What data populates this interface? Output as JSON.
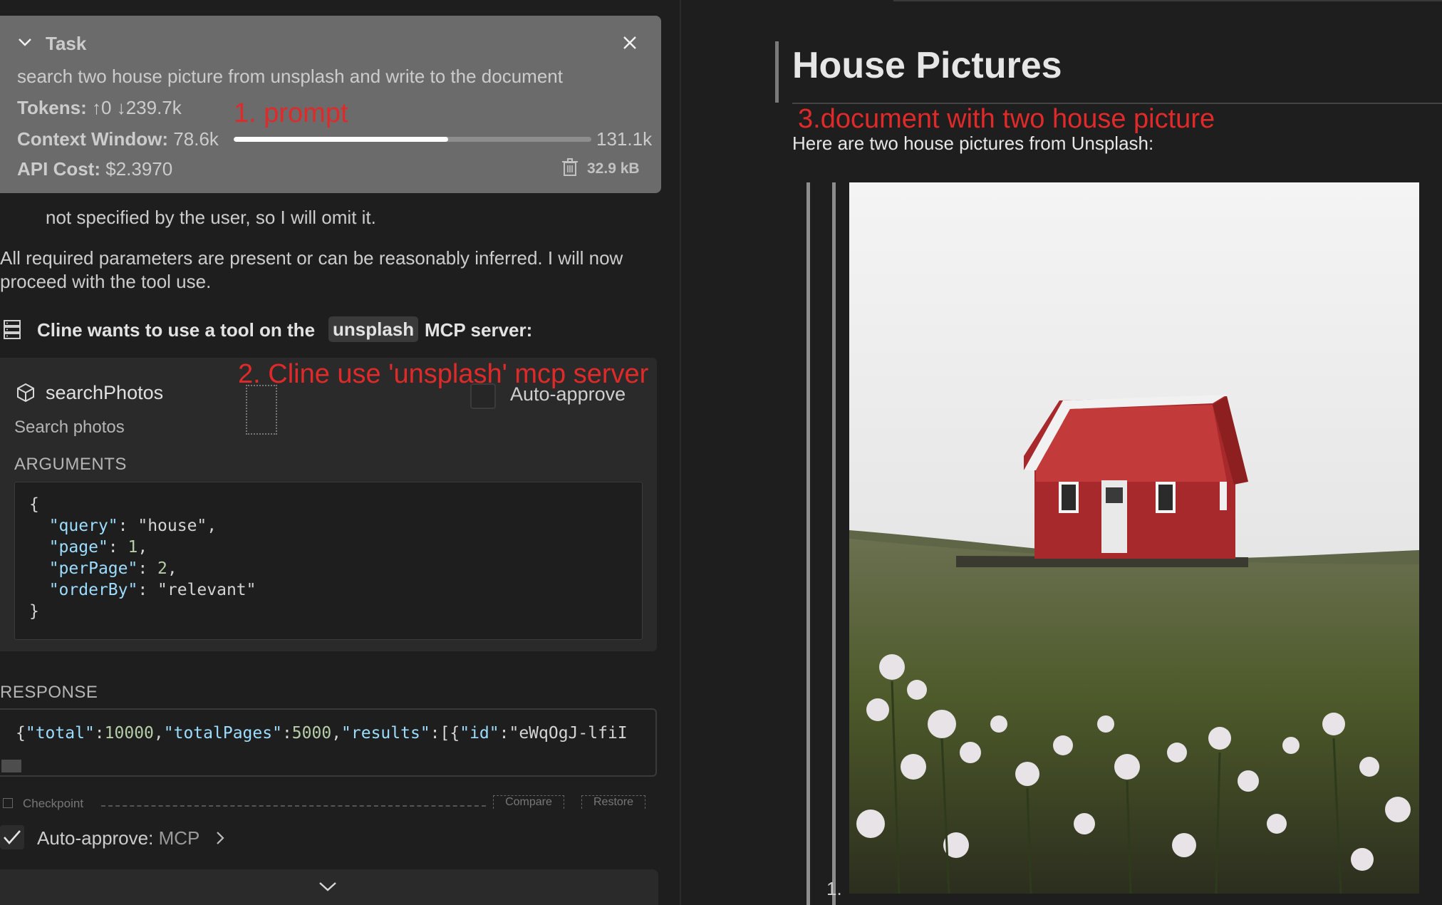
{
  "task": {
    "title": "Task",
    "text": "search two house picture from unsplash and write to the document",
    "tokens_label": "Tokens:",
    "tokens_up": "0",
    "tokens_down": "239.7k",
    "context_label": "Context Window:",
    "context_used": "78.6k",
    "context_max": "131.1k",
    "context_fraction": 0.6,
    "cost_label": "API Cost:",
    "cost_value": "$2.3970",
    "size": "32.9 kB"
  },
  "annotations": {
    "a1": "1. prompt",
    "a2": "2. Cline use 'unsplash' mcp server",
    "a3": "3.document with two house picture"
  },
  "chat": {
    "line1": "not specified by the user, so I will omit it.",
    "line2": "All required parameters are present or can be reasonably inferred. I will now",
    "line3": "proceed with the tool use.",
    "mcp_prefix": "Cline wants to use a tool on the",
    "mcp_server": "unsplash",
    "mcp_suffix": "MCP server:"
  },
  "tool": {
    "name": "searchPhotos",
    "description": "Search photos",
    "auto_approve": "Auto-approve",
    "arguments_label": "ARGUMENTS",
    "args": {
      "open": "{",
      "query_key": "\"query\"",
      "query_val": "\"house\"",
      "page_key": "\"page\"",
      "page_val": "1",
      "perPage_key": "\"perPage\"",
      "perPage_val": "2",
      "orderBy_key": "\"orderBy\"",
      "orderBy_val": "\"relevant\"",
      "close": "}"
    },
    "response_label": "RESPONSE"
  },
  "response_line": {
    "p1": "{",
    "k1": "\"total\"",
    "v1": "10000",
    "k2": "\"totalPages\"",
    "v2": "5000",
    "k3": "\"results\"",
    "p2": ":[{",
    "k4": "\"id\"",
    "v4": "\"eWqOgJ-lfiI"
  },
  "checkpoint": {
    "label": "Checkpoint",
    "compare": "Compare",
    "restore": "Restore"
  },
  "auto_approve_bar": {
    "label": "Auto-approve:",
    "value": "MCP"
  },
  "document": {
    "title": "House Pictures",
    "intro": "Here are two house pictures from Unsplash:",
    "list_number": "1."
  },
  "icons": {
    "task_toggle": "chevron-down-icon",
    "close": "close-icon",
    "trash": "trash-icon",
    "server": "server-icon",
    "tool": "cube-icon",
    "check": "check-icon",
    "expand": "chevron-right-icon",
    "scroll": "chevron-down-icon"
  },
  "colors": {
    "annotation": "#e02a2a",
    "json_key": "#9cdcfe",
    "json_number": "#b5cea8"
  }
}
